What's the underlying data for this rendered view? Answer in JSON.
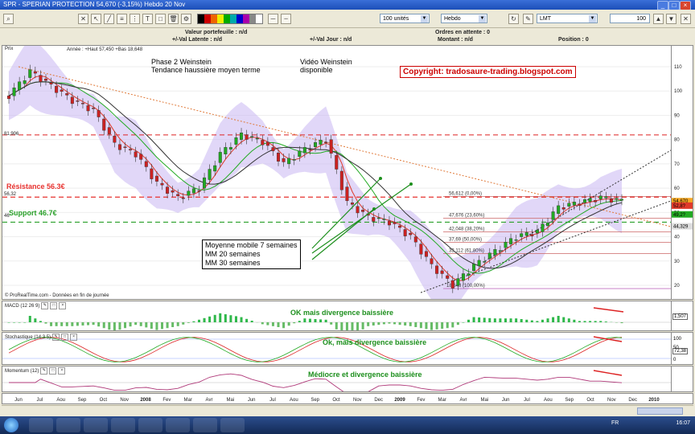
{
  "window": {
    "title": "SPR - SPERIAN PROTECTION    54,670 (-3,15%)   Hebdo   20 Nov"
  },
  "toolbar": {
    "units": "100 unités",
    "period": "Hebdo",
    "order_type": "LMT",
    "quantity": "100"
  },
  "info": {
    "portefeuille": "Valeur portefeuille : n/d",
    "val_latente": "+/-Val Latente : n/d",
    "val_jour": "+/-Val Jour : n/d",
    "ordres": "Ordres en attente : 0",
    "montant": "Montant : n/d",
    "position": "Position : 0"
  },
  "price_panel": {
    "label": "Prix",
    "header_stats": "Année : +Haut 57,450 +Bas 18,648",
    "annotation_phase": "Phase 2 Weinstein",
    "annotation_trend": "Tendance haussière moyen terme",
    "annotation_video1": "Vidéo Weinstein",
    "annotation_video2": "disponible",
    "copyright": "Copyright: tradosaure-trading.blogspot.com",
    "resistance": "Résistance 56.3€",
    "support": "Support 46.7€",
    "level_81": "81,906",
    "level_56": "56,32",
    "level_46": "46",
    "ma_box_1": "Moyenne mobile 7 semaines",
    "ma_box_2": "MM 20 semaines",
    "ma_box_3": "MM 30 semaines",
    "source": "© ProRealTime.com - Données en fin de journée",
    "current_price": "54,670"
  },
  "fib_labels": [
    "56,612 (0,00%)",
    "47,676 (23,60%)",
    "42,048 (38,20%)",
    "37,69 (50,00%)",
    "33,112 (61,80%)",
    "18,648 (100,00%)"
  ],
  "price_axis_ticks": [
    "110",
    "100",
    "90",
    "80",
    "70",
    "60",
    "50",
    "40",
    "30",
    "20"
  ],
  "price_axis_tags": [
    "54,670",
    "52,8?",
    "49,2?",
    "44,329"
  ],
  "macd": {
    "label": "MACD (12 26 9)",
    "comment": "OK mais divergence baissière",
    "value": "1,507"
  },
  "stoch": {
    "label": "Stochastique (14 3 5)",
    "comment": "Ok, mais divergence baissière",
    "ticks": [
      "100",
      "50",
      "0"
    ],
    "value": "72,38"
  },
  "momentum": {
    "label": "Momentum (12)",
    "comment": "Médiocre et divergence baissière"
  },
  "time_axis": [
    "Jun",
    "Jul",
    "Aou",
    "Sep",
    "Oct",
    "Nov",
    "2008",
    "Fev",
    "Mar",
    "Avr",
    "Mai",
    "Jun",
    "Jul",
    "Aou",
    "Sep",
    "Oct",
    "Nov",
    "Dec",
    "2009",
    "Fev",
    "Mar",
    "Avr",
    "Mai",
    "Jun",
    "Jul",
    "Aou",
    "Sep",
    "Oct",
    "Nov",
    "Dec",
    "2010"
  ],
  "taskbar": {
    "clock": "16:07",
    "lang": "FR"
  },
  "colors": {
    "resistance": "#e8322f",
    "support": "#2aa02a",
    "ma7": "#e03a2a",
    "ma20": "#22aa22",
    "ma30": "#333333",
    "band": "#c9b6f2",
    "annotation_green": "#1d8f1d",
    "copyright": "#cc0000"
  },
  "chart_data": {
    "type": "candlestick",
    "title": "SPR - SPERIAN PROTECTION",
    "ylim": [
      15,
      115
    ],
    "x": [
      "2007-06",
      "2007-07",
      "2007-08",
      "2007-09",
      "2007-10",
      "2007-11",
      "2007-12",
      "2008-01",
      "2008-02",
      "2008-03",
      "2008-04",
      "2008-05",
      "2008-06",
      "2008-07",
      "2008-08",
      "2008-09",
      "2008-10",
      "2008-11",
      "2008-12",
      "2009-01",
      "2009-02",
      "2009-03",
      "2009-04",
      "2009-05",
      "2009-06",
      "2009-07",
      "2009-08",
      "2009-09",
      "2009-10",
      "2009-11"
    ],
    "close": [
      98,
      108,
      102,
      96,
      92,
      78,
      74,
      62,
      56,
      60,
      74,
      82,
      79,
      70,
      76,
      80,
      54,
      48,
      46,
      40,
      28,
      20,
      28,
      34,
      40,
      42,
      52,
      54,
      56,
      54.67
    ],
    "levels": {
      "resistance": 56.32,
      "support": 46,
      "old_high": 81.906
    },
    "fibonacci": [
      56.612,
      47.676,
      42.048,
      37.69,
      33.112,
      18.648
    ]
  }
}
